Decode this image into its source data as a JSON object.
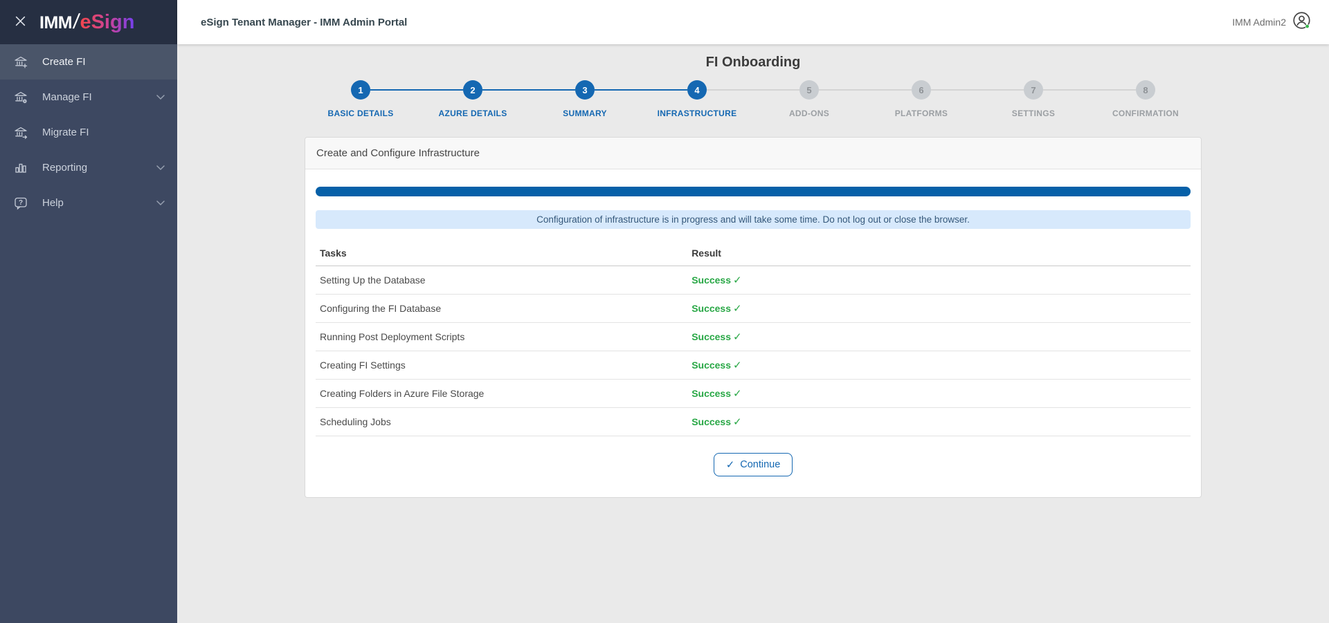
{
  "icons": {
    "check": "✓"
  },
  "colors": {
    "accent_blue": "#1568b2",
    "progress_blue": "#0660a8",
    "success_green": "#28a745",
    "banner_bg": "#d7e9fc",
    "sidebar_bg": "#3d4861",
    "sidebar_active_bg": "#4a5569"
  },
  "sidebar": {
    "logo": {
      "imm": "IMM",
      "slash": "/",
      "esign": "eSign"
    },
    "items": [
      {
        "label": "Create FI",
        "icon": "bank-plus-icon",
        "active": true,
        "expandable": false
      },
      {
        "label": "Manage FI",
        "icon": "bank-gear-icon",
        "active": false,
        "expandable": true
      },
      {
        "label": "Migrate FI",
        "icon": "bank-arrow-icon",
        "active": false,
        "expandable": false
      },
      {
        "label": "Reporting",
        "icon": "bar-chart-icon",
        "active": false,
        "expandable": true
      },
      {
        "label": "Help",
        "icon": "help-bubble-icon",
        "active": false,
        "expandable": true
      }
    ]
  },
  "header": {
    "title": "eSign Tenant Manager - IMM Admin Portal",
    "user": "IMM Admin2",
    "user_status": "online"
  },
  "page": {
    "title": "FI Onboarding"
  },
  "stepper": {
    "steps": [
      {
        "number": "1",
        "label": "BASIC DETAILS",
        "status": "completed"
      },
      {
        "number": "2",
        "label": "AZURE DETAILS",
        "status": "completed"
      },
      {
        "number": "3",
        "label": "SUMMARY",
        "status": "completed"
      },
      {
        "number": "4",
        "label": "INFRASTRUCTURE",
        "status": "completed"
      },
      {
        "number": "5",
        "label": "ADD-ONS",
        "status": "upcoming"
      },
      {
        "number": "6",
        "label": "PLATFORMS",
        "status": "upcoming"
      },
      {
        "number": "7",
        "label": "SETTINGS",
        "status": "upcoming"
      },
      {
        "number": "8",
        "label": "CONFIRMATION",
        "status": "upcoming"
      }
    ]
  },
  "card": {
    "title": "Create and Configure Infrastructure",
    "progress_percent": 100,
    "banner": "Configuration of infrastructure is in progress and will take some time. Do not log out or close the browser.",
    "table": {
      "headers": {
        "tasks": "Tasks",
        "result": "Result"
      },
      "rows": [
        {
          "task": "Setting Up the Database",
          "result": "Success"
        },
        {
          "task": "Configuring the FI Database",
          "result": "Success"
        },
        {
          "task": "Running Post Deployment Scripts",
          "result": "Success"
        },
        {
          "task": "Creating FI Settings",
          "result": "Success"
        },
        {
          "task": "Creating Folders in Azure File Storage",
          "result": "Success"
        },
        {
          "task": "Scheduling Jobs",
          "result": "Success"
        }
      ]
    },
    "continue_label": "Continue"
  }
}
